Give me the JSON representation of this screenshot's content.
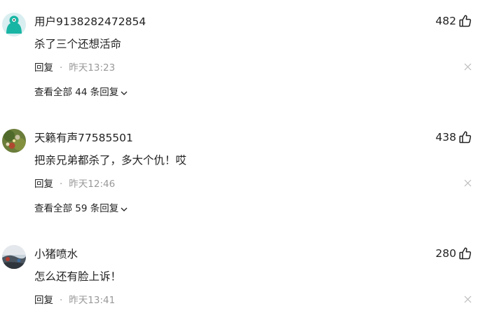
{
  "comments": [
    {
      "username": "用户9138282472854",
      "text": "杀了三个还想活命",
      "likes": "482",
      "reply_label": "回复",
      "dot": "·",
      "time": "昨天13:23",
      "view_all": "查看全部 44 条回复",
      "avatar_icon": "teal-bird-avatar"
    },
    {
      "username": "天籁有声77585501",
      "text": "把亲兄弟都杀了，多大个仇！哎",
      "likes": "438",
      "reply_label": "回复",
      "dot": "·",
      "time": "昨天12:46",
      "view_all": "查看全部 59 条回复",
      "avatar_icon": "flower-photo-avatar"
    },
    {
      "username": "小猪喷水",
      "text": "怎么还有脸上诉！",
      "likes": "280",
      "reply_label": "回复",
      "dot": "·",
      "time": "昨天13:41",
      "avatar_icon": "landscape-photo-avatar"
    }
  ],
  "colors": {
    "text": "#222222",
    "muted": "#999999",
    "avatar_teal": "#18b5a4"
  }
}
